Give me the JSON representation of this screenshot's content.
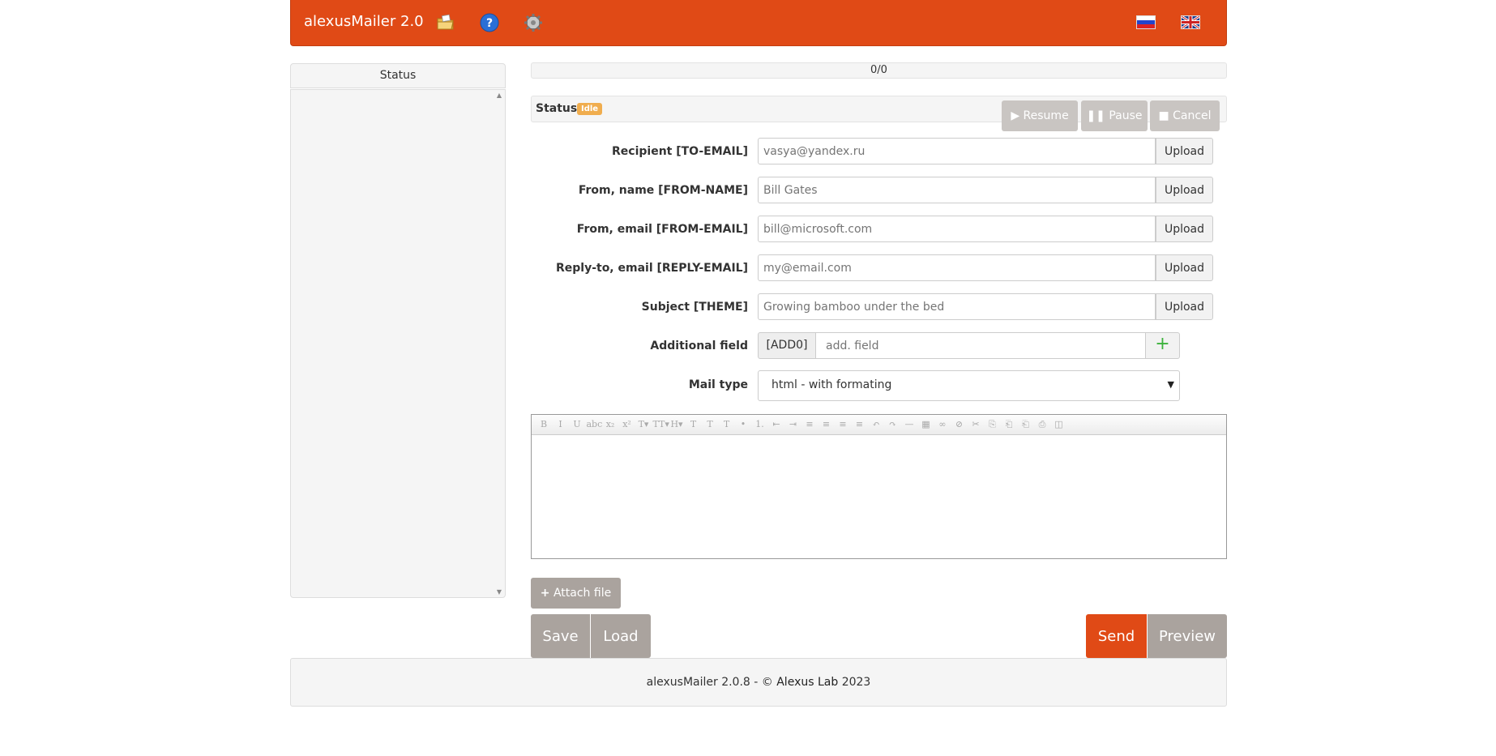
{
  "app": {
    "title": "alexusMailer 2.0"
  },
  "header": {
    "icons": [
      "folder-icon",
      "help-icon",
      "settings-icon"
    ],
    "flags": [
      "russian-flag-icon",
      "uk-flag-icon"
    ]
  },
  "sidebar": {
    "title": "Status"
  },
  "progress": {
    "text": "0/0",
    "value": 0
  },
  "status": {
    "label": "Status:",
    "badge": "Idle",
    "buttons": {
      "resume": "Resume",
      "pause": "Pause",
      "cancel": "Cancel"
    }
  },
  "form": {
    "fields": [
      {
        "label": "Recipient [TO-EMAIL]",
        "placeholder": "vasya@yandex.ru",
        "button": "Upload"
      },
      {
        "label": "From, name [FROM-NAME]",
        "placeholder": "Bill Gates",
        "button": "Upload"
      },
      {
        "label": "From, email [FROM-EMAIL]",
        "placeholder": "bill@microsoft.com",
        "button": "Upload"
      },
      {
        "label": "Reply-to, email [REPLY-EMAIL]",
        "placeholder": "my@email.com",
        "button": "Upload"
      },
      {
        "label": "Subject [THEME]",
        "placeholder": "Growing bamboo under the bed",
        "button": "Upload"
      }
    ],
    "additional": {
      "label": "Additional field",
      "addon": "[ADD0]",
      "placeholder": "add. field",
      "plus": "+"
    },
    "mail_type": {
      "label": "Mail type",
      "value": "html - with formating"
    }
  },
  "editor": {
    "toolbar": [
      "B",
      "I",
      "U",
      "abc",
      "x₂",
      "x²",
      "T▾",
      "TT▾",
      "H▾",
      "T",
      "T",
      "T",
      "•",
      "1.",
      "⇤",
      "⇥",
      "≡",
      "≡",
      "≡",
      "≡",
      "↶",
      "↷",
      "—",
      "▦",
      "∞",
      "⊘",
      "✂",
      "⎘",
      "⎗",
      "⎗",
      "⎙",
      "◫"
    ]
  },
  "actions": {
    "attach": "Attach file",
    "save": "Save",
    "load": "Load",
    "send": "Send",
    "preview": "Preview"
  },
  "footer": {
    "prefix": "alexusMailer 2.0.8 - © ",
    "link": "Alexus Lab",
    "year": " 2023"
  },
  "colors": {
    "accent": "#e04a16",
    "muted_button": "#aaa39e",
    "badge": "#f0ad4e"
  }
}
